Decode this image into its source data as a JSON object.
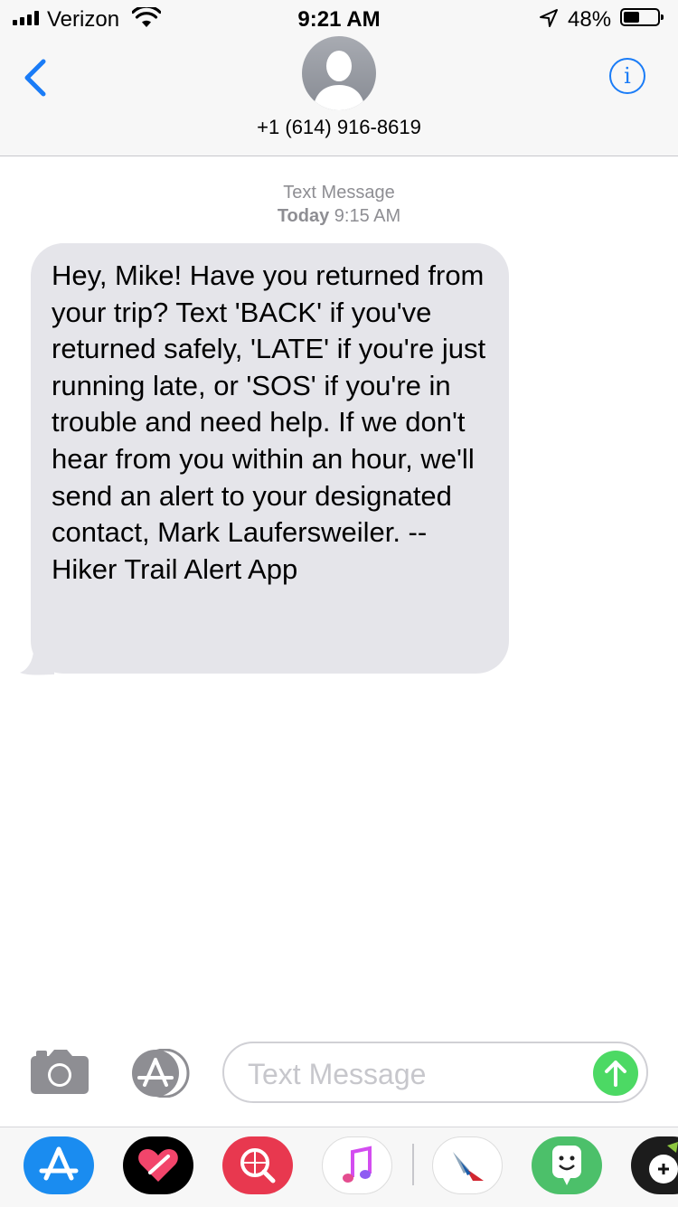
{
  "status_bar": {
    "carrier": "Verizon",
    "time": "9:21 AM",
    "battery_percent": "48%",
    "battery_level": 0.48
  },
  "header": {
    "contact_number": "+1 (614) 916-8619",
    "back_icon": "chevron-left-icon",
    "info_icon": "info-icon",
    "info_glyph": "i"
  },
  "conversation": {
    "timestamp_label": "Text Message",
    "timestamp_day": "Today",
    "timestamp_time": "9:15 AM",
    "messages": [
      {
        "direction": "incoming",
        "text": "Hey, Mike! Have you returned from your trip? Text 'BACK' if you've returned safely, 'LATE' if you're just running late, or 'SOS' if you're in trouble and need help. If we don't hear from you within an hour, we'll send an alert to your designated contact, Mark Laufersweiler. --Hiker Trail Alert App"
      }
    ]
  },
  "composer": {
    "placeholder": "Text Message",
    "camera_icon": "camera-icon",
    "apps_icon": "app-store-icon",
    "send_icon": "send-arrow-icon"
  },
  "app_drawer": {
    "apps": [
      {
        "name": "app-store",
        "color": "#1a8cf0"
      },
      {
        "name": "digital-touch",
        "color": "#000000"
      },
      {
        "name": "web-images",
        "color": "#e8384f"
      },
      {
        "name": "music",
        "color": "#ffffff"
      },
      {
        "name": "american-airlines",
        "color": "#ffffff"
      },
      {
        "name": "bitmoji",
        "color": "#4cc06a"
      },
      {
        "name": "game",
        "color": "#1c1c1c"
      }
    ]
  },
  "colors": {
    "accent": "#1a7cf7",
    "bubble_gray": "#e5e5ea",
    "send_green": "#4cd964",
    "timestamp_gray": "#8e8e93"
  }
}
